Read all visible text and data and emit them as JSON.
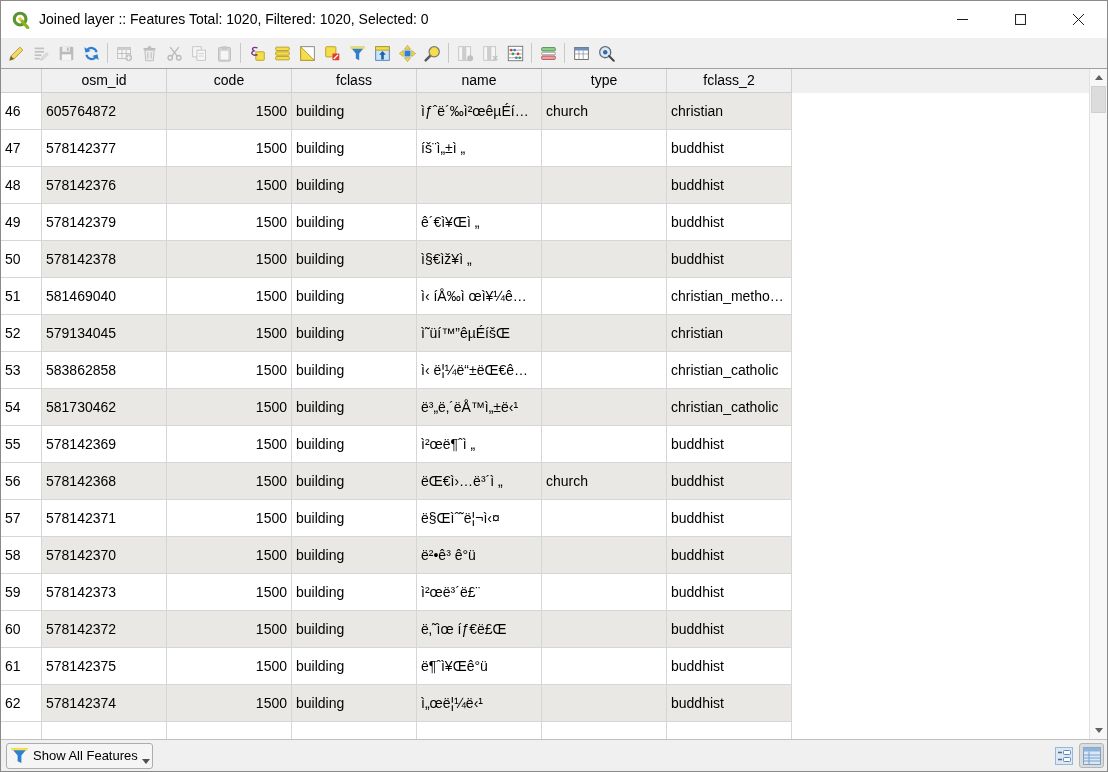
{
  "window": {
    "title": "Joined layer :: Features Total: 1020, Filtered: 1020, Selected: 0"
  },
  "toolbar": {
    "groups": [
      [
        {
          "kind": "toggle-edit",
          "disabled": false
        },
        {
          "kind": "multi-edit",
          "disabled": true
        },
        {
          "kind": "save",
          "disabled": true
        },
        {
          "kind": "reload",
          "disabled": false
        }
      ],
      [
        {
          "kind": "add-feature",
          "disabled": true
        },
        {
          "kind": "delete-feature",
          "disabled": true
        },
        {
          "kind": "cut",
          "disabled": true
        },
        {
          "kind": "copy",
          "disabled": true
        },
        {
          "kind": "paste",
          "disabled": true
        }
      ],
      [
        {
          "kind": "select-expression",
          "disabled": false
        },
        {
          "kind": "select-all",
          "disabled": false
        },
        {
          "kind": "invert-selection",
          "disabled": false
        },
        {
          "kind": "deselect",
          "disabled": false
        },
        {
          "kind": "filter-selected",
          "disabled": false
        },
        {
          "kind": "move-to-top",
          "disabled": false
        },
        {
          "kind": "pan-to-selected",
          "disabled": false
        },
        {
          "kind": "zoom-to-selected",
          "disabled": false
        }
      ],
      [
        {
          "kind": "new-field",
          "disabled": true
        },
        {
          "kind": "delete-field",
          "disabled": true
        },
        {
          "kind": "field-calculator",
          "disabled": false
        }
      ],
      [
        {
          "kind": "conditional-formatting",
          "disabled": false
        }
      ],
      [
        {
          "kind": "dock",
          "disabled": false
        },
        {
          "kind": "actions",
          "disabled": false
        }
      ]
    ]
  },
  "table": {
    "columns": [
      {
        "label": "osm_id",
        "kind": "text"
      },
      {
        "label": "code",
        "kind": "number"
      },
      {
        "label": "fclass",
        "kind": "text"
      },
      {
        "label": "name",
        "kind": "text"
      },
      {
        "label": "type",
        "kind": "text"
      },
      {
        "label": "fclass_2",
        "kind": "text"
      }
    ],
    "rows": [
      {
        "number": "46",
        "cells": [
          "605764872",
          "1500",
          "building",
          "ìƒˆë´‰ì²œêµÉí…",
          "church",
          "christian"
        ]
      },
      {
        "number": "47",
        "cells": [
          "578142377",
          "1500",
          "building",
          "íš¨ì„±ì „",
          null,
          "buddhist"
        ]
      },
      {
        "number": "48",
        "cells": [
          "578142376",
          "1500",
          "building",
          null,
          null,
          "buddhist"
        ]
      },
      {
        "number": "49",
        "cells": [
          "578142379",
          "1500",
          "building",
          "ê´€ì¥Œì „",
          null,
          "buddhist"
        ]
      },
      {
        "number": "50",
        "cells": [
          "578142378",
          "1500",
          "building",
          "ì§€ìž¥ì „",
          null,
          "buddhist"
        ]
      },
      {
        "number": "51",
        "cells": [
          "581469040",
          "1500",
          "building",
          "ì‹ íÅ‰ì œì¥¼ê…",
          null,
          "christian_metho…"
        ]
      },
      {
        "number": "52",
        "cells": [
          "579134045",
          "1500",
          "building",
          "ì˜üí™”êµÉíšŒ",
          null,
          "christian"
        ]
      },
      {
        "number": "53",
        "cells": [
          "583862858",
          "1500",
          "building",
          "ì‹ ë¦¼ë“±ëŒ€ê…",
          null,
          "christian_catholic"
        ]
      },
      {
        "number": "54",
        "cells": [
          "581730462",
          "1500",
          "building",
          "ë³„ë‚´ëÅ™ì„±ë‹¹",
          null,
          "christian_catholic"
        ]
      },
      {
        "number": "55",
        "cells": [
          "578142369",
          "1500",
          "building",
          "ì²œë¶ˆì „",
          null,
          "buddhist"
        ]
      },
      {
        "number": "56",
        "cells": [
          "578142368",
          "1500",
          "building",
          "ëŒ€ì›…ë³´ì „",
          "church",
          "buddhist"
        ]
      },
      {
        "number": "57",
        "cells": [
          "578142371",
          "1500",
          "building",
          "ë§Œìˆ˜ë¦¬ì‹¤",
          null,
          "buddhist"
        ]
      },
      {
        "number": "58",
        "cells": [
          "578142370",
          "1500",
          "building",
          "ë²•ê³ ê°ü",
          null,
          "buddhist"
        ]
      },
      {
        "number": "59",
        "cells": [
          "578142373",
          "1500",
          "building",
          "ì²œë³´ë£¨",
          null,
          "buddhist"
        ]
      },
      {
        "number": "60",
        "cells": [
          "578142372",
          "1500",
          "building",
          "ë‚˜ìœ íƒ€ë£Œ",
          null,
          "buddhist"
        ]
      },
      {
        "number": "61",
        "cells": [
          "578142375",
          "1500",
          "building",
          "ë¶ˆì¥Œê°ü",
          null,
          "buddhist"
        ]
      },
      {
        "number": "62",
        "cells": [
          "578142374",
          "1500",
          "building",
          "ì„œë¦¼ë‹¹",
          null,
          "buddhist"
        ]
      }
    ]
  },
  "bottom_bar": {
    "filter_button": {
      "label": "Show All Features"
    },
    "views": [
      {
        "kind": "form",
        "selected": false
      },
      {
        "kind": "table",
        "selected": true
      }
    ]
  }
}
